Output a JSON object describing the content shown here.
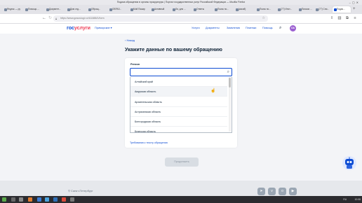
{
  "window": {
    "title": "Подача обращения в органы прокуратуры | Портал государственных услуг Российской Федерации — Mozilla Firefox",
    "controls": "–▢✕"
  },
  "tabs": [
    {
      "label": "Яндекс — ру"
    },
    {
      "label": "Помощь ..."
    },
    {
      "label": "Документ..."
    },
    {
      "label": "Дом отд..."
    },
    {
      "label": "Обращ..."
    },
    {
      "label": "ОБРАЗ..."
    },
    {
      "label": "Мой Пожар"
    },
    {
      "label": "Активный"
    },
    {
      "label": "Ли, для ..."
    },
    {
      "label": "Ответы"
    },
    {
      "label": "Поиск по..."
    },
    {
      "label": "(какой)"
    },
    {
      "label": "Поиск по..."
    },
    {
      "label": "(77) Инст..."
    },
    {
      "label": "Письмо ..."
    },
    {
      "label": "(77) Спи..."
    },
    {
      "label": "Подач..."
    }
  ],
  "navbar": {
    "url": "https://www.gosuslugi.ru/411888/1/form",
    "back": "←",
    "forward": "→",
    "reload": "↻"
  },
  "site": {
    "logo_part1": "гос",
    "logo_part2": "услуги",
    "region_selector": "Приморские ▾",
    "menu": [
      "Услуги",
      "Документы",
      "Заявления",
      "Платежи",
      "Помощь"
    ],
    "avatar_initials": "ОА"
  },
  "main": {
    "back_link": "‹ Назад",
    "title": "Укажите данные по вашему обращению",
    "region_label": "Регион",
    "region_input_value": "",
    "region_options": [
      "Алтайский край",
      "Амурская область",
      "Архангельская область",
      "Астраханская область",
      "Белгородская область",
      "Брянская область"
    ],
    "requirements_link": "Требования к тексту обращения",
    "continue_button": "Продолжить"
  },
  "footer": {
    "location": "Санкт-Петербург"
  },
  "taskbar": {
    "language": "RU",
    "clock": "10:08"
  },
  "colors": {
    "brand_blue": "#0d4cd3",
    "brand_red": "#ee3f58",
    "page_bg": "#f3f4f7"
  }
}
